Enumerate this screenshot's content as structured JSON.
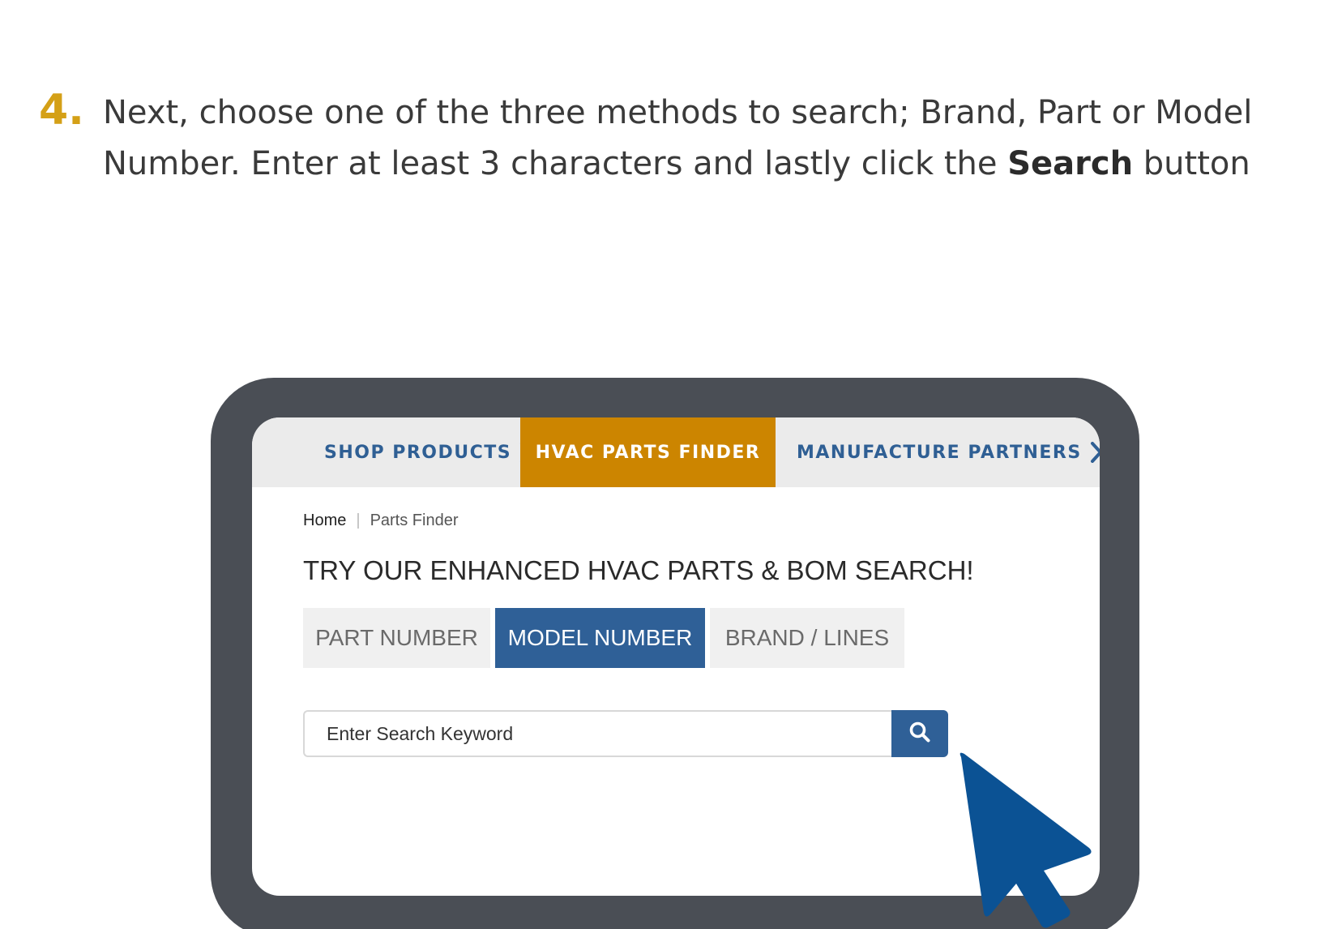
{
  "instruction": {
    "step_number": "4.",
    "text_before": "Next, choose one of the three methods to search; Brand, Part or Model Number. Enter at least 3 characters and lastly click the ",
    "text_bold": "Search",
    "text_after": " button"
  },
  "nav": {
    "shop_products": "SHOP PRODUCTS",
    "hvac_parts_finder": "HVAC PARTS FINDER",
    "manufacture_partners": "MANUFACTURE PARTNERS"
  },
  "breadcrumb": {
    "home": "Home",
    "separator": "|",
    "current": "Parts Finder"
  },
  "page_title": "TRY OUR ENHANCED HVAC PARTS & BOM SEARCH!",
  "tabs": [
    {
      "label": "PART NUMBER",
      "active": false
    },
    {
      "label": "MODEL NUMBER",
      "active": true
    },
    {
      "label": "BRAND / LINES",
      "active": false
    }
  ],
  "search": {
    "placeholder": "Enter Search Keyword",
    "value": ""
  },
  "icons": {
    "search_button_icon": "search-icon",
    "nav_chevron": "chevron-right-icon",
    "pointer": "cursor-arrow-icon"
  },
  "colors": {
    "accent_gold": "#d4a017",
    "finder_orange": "#cc8500",
    "brand_blue": "#2f6097",
    "frame_gray": "#4a4e55",
    "cursor_blue": "#0b5294"
  }
}
